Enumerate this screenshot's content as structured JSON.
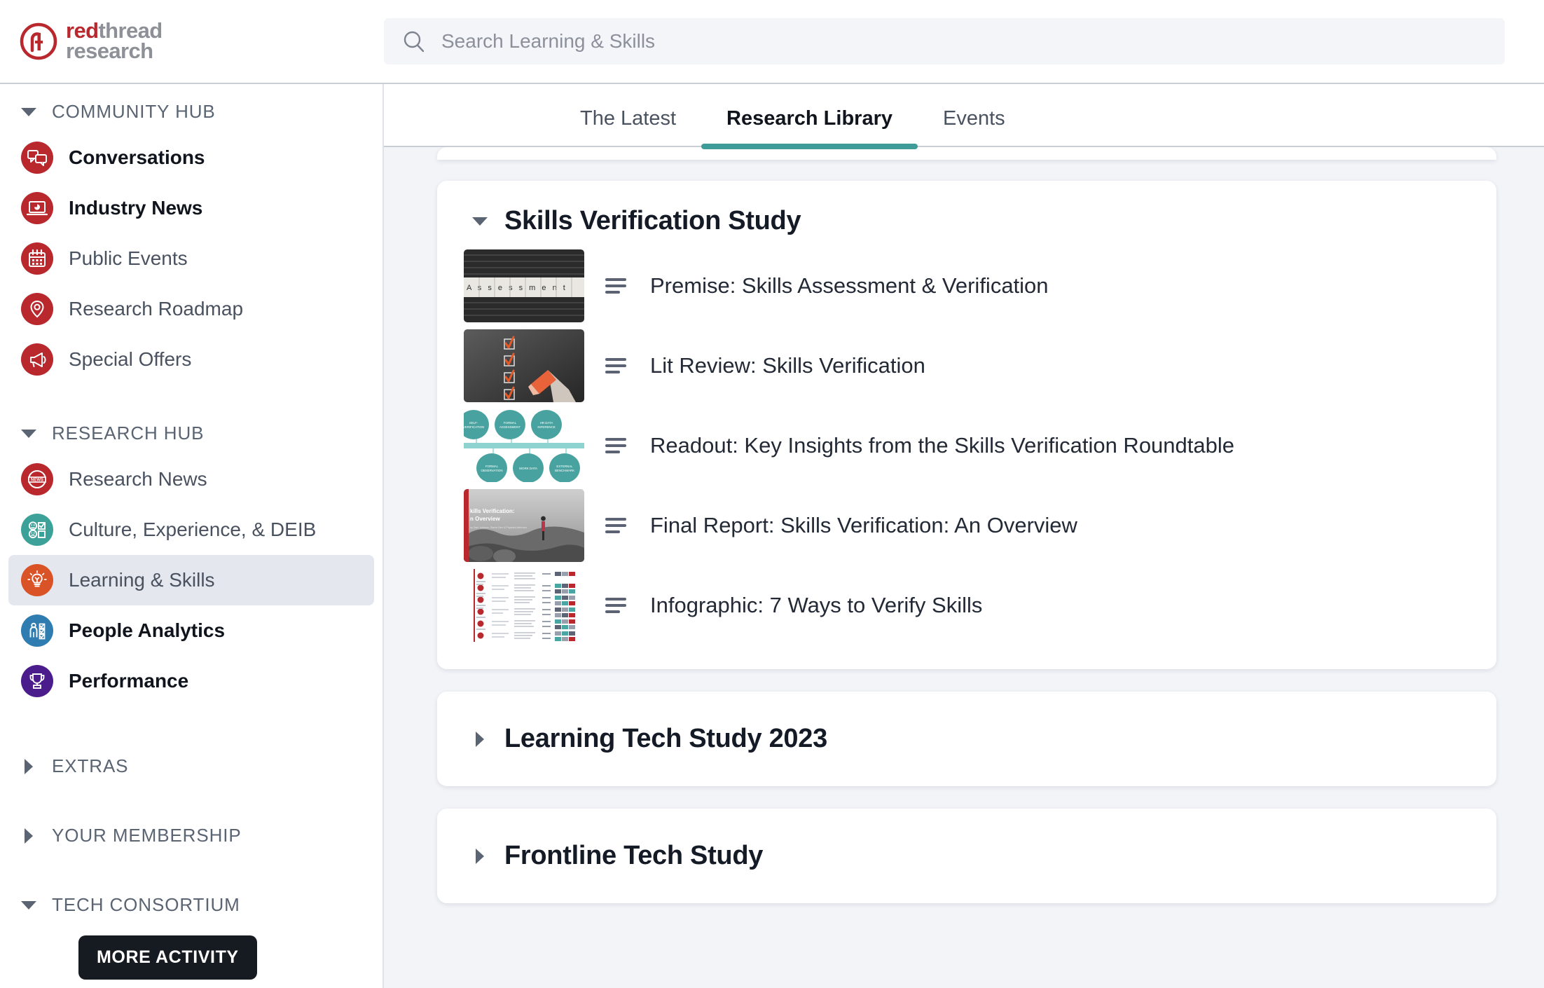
{
  "brand": {
    "logo_line1_red": "red",
    "logo_line1_gray": "thread",
    "logo_line2": "research",
    "accent_red": "#b9282d",
    "accent_teal": "#3d9c98",
    "accent_gray": "#8d9097"
  },
  "search": {
    "placeholder": "Search Learning & Skills",
    "value": "",
    "icon": "search-icon"
  },
  "sidebar": {
    "sections": [
      {
        "label": "COMMUNITY HUB",
        "expanded": true,
        "icon": "chevron-down-icon",
        "items": [
          {
            "label": "Conversations",
            "icon": "chat-bubbles-icon",
            "color": "#b9282d",
            "bold": true,
            "active": false
          },
          {
            "label": "Industry News",
            "icon": "laptop-chart-icon",
            "color": "#b9282d",
            "bold": true,
            "active": false
          },
          {
            "label": "Public Events",
            "icon": "calendar-icon",
            "color": "#b9282d",
            "bold": false,
            "active": false
          },
          {
            "label": "Research Roadmap",
            "icon": "map-pin-icon",
            "color": "#b9282d",
            "bold": false,
            "active": false
          },
          {
            "label": "Special Offers",
            "icon": "megaphone-icon",
            "color": "#b9282d",
            "bold": false,
            "active": false
          }
        ]
      },
      {
        "label": "RESEARCH HUB",
        "expanded": true,
        "icon": "chevron-down-icon",
        "items": [
          {
            "label": "Research News",
            "icon": "news-badge-icon",
            "color": "#b9282d",
            "bold": false,
            "active": false
          },
          {
            "label": "Culture, Experience, & DEIB",
            "icon": "faces-survey-icon",
            "color": "#3ca299",
            "bold": false,
            "active": false
          },
          {
            "label": "Learning & Skills",
            "icon": "lightbulb-icon",
            "color": "#da5327",
            "bold": false,
            "active": true
          },
          {
            "label": "People Analytics",
            "icon": "person-checklist-icon",
            "color": "#2e7cb0",
            "bold": true,
            "active": false
          },
          {
            "label": "Performance",
            "icon": "trophy-icon",
            "color": "#4b1d8c",
            "bold": true,
            "active": false
          }
        ]
      },
      {
        "label": "EXTRAS",
        "expanded": false,
        "icon": "chevron-right-icon",
        "items": []
      },
      {
        "label": "YOUR MEMBERSHIP",
        "expanded": false,
        "icon": "chevron-right-icon",
        "items": []
      },
      {
        "label": "TECH CONSORTIUM",
        "expanded": true,
        "icon": "chevron-down-icon",
        "items": []
      }
    ],
    "tooltip": "MORE ACTIVITY"
  },
  "tabs": [
    {
      "label": "The Latest",
      "active": false
    },
    {
      "label": "Research Library",
      "active": true
    },
    {
      "label": "Events",
      "active": false
    }
  ],
  "main": {
    "studies": [
      {
        "title": "Skills Verification Study",
        "expanded": true,
        "toggle_icon": "chevron-down-icon",
        "items": [
          {
            "title": "Premise: Skills Assessment & Verification",
            "icon": "article-lines-icon",
            "thumb": "assessment-wood-tiles"
          },
          {
            "title": "Lit Review: Skills Verification",
            "icon": "article-lines-icon",
            "thumb": "checklist-pencil"
          },
          {
            "title": "Readout: Key Insights from the Skills Verification Roundtable",
            "icon": "article-lines-icon",
            "thumb": "teal-timeline-diagram"
          },
          {
            "title": "Final Report: Skills Verification: An Overview",
            "icon": "article-lines-icon",
            "thumb": "report-cover-rocks"
          },
          {
            "title": "Infographic: 7 Ways to Verify Skills",
            "icon": "article-lines-icon",
            "thumb": "infographic-table"
          }
        ]
      },
      {
        "title": "Learning Tech Study 2023",
        "expanded": false,
        "toggle_icon": "chevron-right-icon",
        "items": []
      },
      {
        "title": "Frontline Tech Study",
        "expanded": false,
        "toggle_icon": "chevron-right-icon",
        "items": []
      }
    ],
    "thumb_labels": {
      "assessment": "Assessment",
      "report_title_l1": "kills Verification:",
      "report_title_l2": "n Overview",
      "diagram_nodes": [
        "SELF-VERIFICATION",
        "FORMAL ASSESSMENT",
        "HR DATA INFERENCE",
        "FORMAL OBSERVATION",
        "WORK DATA",
        "EXTERNAL BENCHMARK"
      ]
    }
  }
}
